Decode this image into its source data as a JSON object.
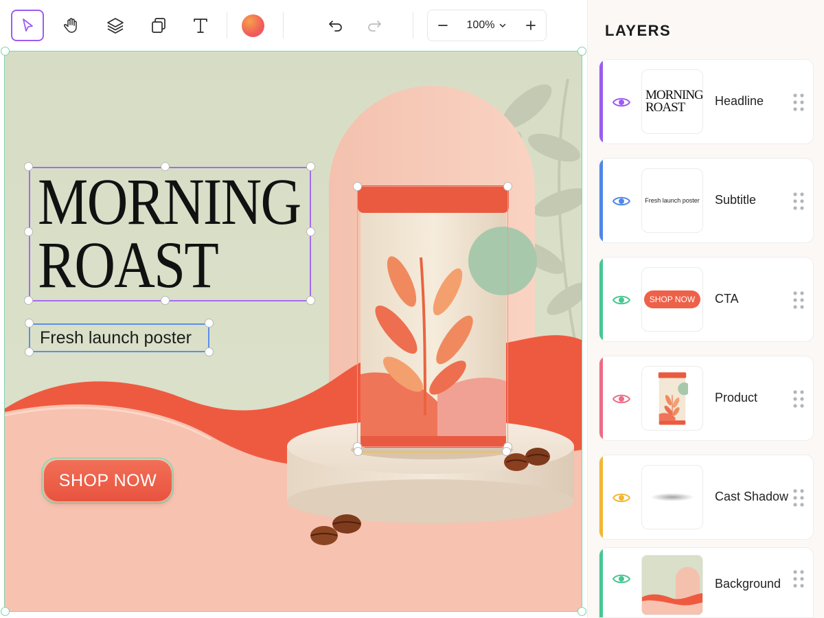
{
  "toolbar": {
    "tools": [
      {
        "name": "select-tool",
        "icon": "cursor-icon",
        "active": true
      },
      {
        "name": "hand-tool",
        "icon": "hand-icon",
        "active": false
      },
      {
        "name": "layers-tool",
        "icon": "layers-icon",
        "active": false
      },
      {
        "name": "frame-tool",
        "icon": "copy-frame-icon",
        "active": false
      },
      {
        "name": "text-tool",
        "icon": "text-icon",
        "active": false
      }
    ],
    "fill_color": "#f05e5a",
    "undo_icon": "undo-icon",
    "redo_icon": "redo-icon",
    "zoom": {
      "value": "100%",
      "decrease_icon": "minus-icon",
      "increase_icon": "plus-icon",
      "dropdown_icon": "chevron-down-icon"
    }
  },
  "canvas": {
    "headline_line1": "MORNING",
    "headline_line2": "ROAST",
    "subtitle": "Fresh launch poster",
    "cta_label": "SHOP NOW",
    "colors": {
      "background": "#d9dfc8",
      "accent": "#ee5a40",
      "arch": "#f6c3b0",
      "headline_selection": "#a46cf2",
      "subtitle_selection": "#5b8fe8",
      "frame_selection": "#7fd3aa"
    }
  },
  "layers_panel": {
    "title": "LAYERS",
    "layers": [
      {
        "label": "Headline",
        "color": "#9b5cf0",
        "thumb_text": "MORNING ROAST"
      },
      {
        "label": "Subtitle",
        "color": "#4f87e8",
        "thumb_text": "Fresh launch poster"
      },
      {
        "label": "CTA",
        "color": "#46c792",
        "thumb_text": "SHOP NOW"
      },
      {
        "label": "Product",
        "color": "#ee6b86",
        "thumb_text": ""
      },
      {
        "label": "Cast Shadow",
        "color": "#f2b731",
        "thumb_text": ""
      },
      {
        "label": "Background",
        "color": "#46c792",
        "thumb_text": ""
      }
    ]
  }
}
